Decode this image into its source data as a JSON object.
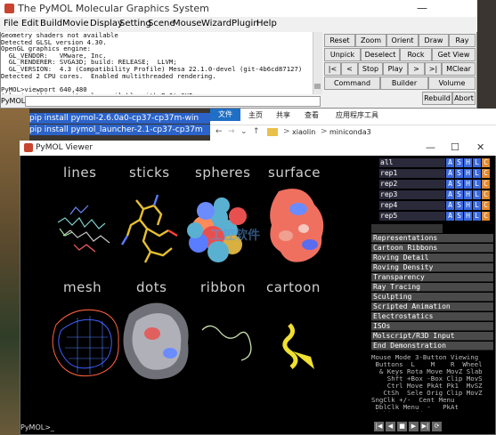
{
  "tk": {
    "title": "The PyMOL Molecular Graphics System",
    "minimize": "—",
    "menu": [
      "File",
      "Edit",
      "Build",
      "Movie",
      "Display",
      "Setting",
      "Scene",
      "Mouse",
      "Wizard",
      "Plugin",
      "Help"
    ],
    "console": "Geometry shaders not available\nDetected GLSL version 4.30.\nOpenGL graphics engine:\n  GL_VENDOR:   VMware, Inc.\n  GL_RENDERER: SVGA3D; build: RELEASE;  LLVM;\n  GL_VERSION:  4.3 (Compatibility Profile) Mesa 22.1.0-devel (git-4b6cd87127)\nDetected 2 CPU cores.  Enabled multithreaded rendering.\n\nPyMOL>viewport 640,480\n'pluginsettings_gui' only available with PyQt GUI.",
    "cmd_label": "PyMOL>",
    "buttons": {
      "reset": "Reset",
      "zoom": "Zoom",
      "orient": "Orient",
      "draw": "Draw",
      "ray": "Ray",
      "unpick": "Unpick",
      "deselect": "Deselect",
      "rock": "Rock",
      "get_view": "Get View",
      "first": "|<",
      "prev": "<",
      "stop": "Stop",
      "play": "Play",
      ">": ">",
      "last": ">|",
      "mclear": "MClear",
      "command": "Command",
      "builder": "Builder",
      "volume": "Volume",
      "rebuild": "Rebuild",
      "abort": "Abort"
    }
  },
  "pip": {
    "line1": "pip install pymol-2.6.0a0-cp37-cp37m-win",
    "line2": "pip install pymol_launcher-2.1-cp37-cp37m"
  },
  "explorer": {
    "tabs": [
      "文件",
      "主页",
      "共享",
      "查看",
      "应用程序工具"
    ],
    "path": [
      "xiaolin",
      "miniconda3"
    ],
    "path_sep": ">"
  },
  "viewer": {
    "title": "PyMOL Viewer",
    "controls": [
      "—",
      "☐",
      "✕"
    ],
    "rep_labels": [
      "lines",
      "sticks",
      "spheres",
      "surface",
      "mesh",
      "dots",
      "ribbon",
      "cartoon"
    ],
    "watermark": "工控软件",
    "cmd_prompt": "PyMOL>_",
    "objects": [
      {
        "name": "all"
      },
      {
        "name": "rep1"
      },
      {
        "name": "rep2"
      },
      {
        "name": "rep3"
      },
      {
        "name": "rep4"
      },
      {
        "name": "rep5"
      }
    ],
    "ashlc": [
      "A",
      "S",
      "H",
      "L",
      "C"
    ],
    "wizard_items": [
      "Representations",
      "Cartoon Ribbons",
      "Roving Detail",
      "Roving Density",
      "Transparency",
      "Ray Tracing",
      "Sculpting",
      "Scripted Animation",
      "Electrostatics",
      "ISOs",
      "Molscript/R3D Input",
      "End Demonstration"
    ],
    "mouse_info": "Mouse Mode 3-Button Viewing\n Buttons  L    M    R  Wheel\n  & Keys Rota Move MovZ Slab\n    Shft +Box -Box Clip MovS\n    Ctrl Move PkAt Pk1  MvSZ\n   CtSh  Sele Orig Clip MovZ\nSngClk +/-  Cent Menu\n DblClk Menu  -   PkAt\nPicking Residues",
    "vcr": [
      "|◀",
      "◀",
      "■",
      "▶",
      "▶|",
      "⟳"
    ],
    "colors": {
      "accent_blue": "#2b63c9",
      "viewer_bg": "#000000",
      "wizard_btn": "#4a4a4a"
    }
  }
}
